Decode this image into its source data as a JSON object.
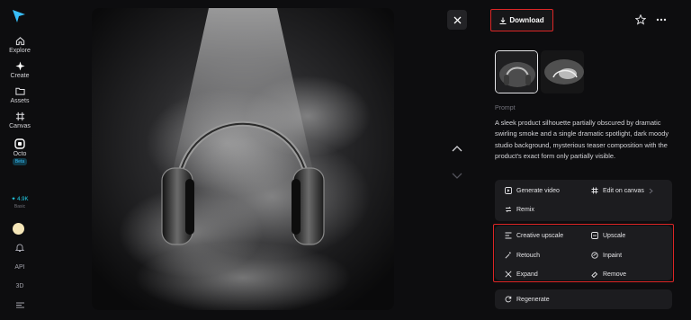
{
  "sidebar": {
    "items": [
      {
        "label": "Explore",
        "icon": "home-icon"
      },
      {
        "label": "Create",
        "icon": "sparkle-icon"
      },
      {
        "label": "Assets",
        "icon": "folder-icon"
      },
      {
        "label": "Canvas",
        "icon": "canvas-icon"
      },
      {
        "label": "Octo",
        "icon": "octo-icon",
        "badge": "Beta"
      }
    ],
    "credits": {
      "value": "4.9K",
      "label": "Basic"
    },
    "bottom": {
      "api": "API",
      "three_d": "3D"
    }
  },
  "viewer": {
    "image_alt": "Headphones silhouette in dramatic swirling smoke under a spotlight"
  },
  "panel": {
    "download_label": "Download",
    "prompt_label": "Prompt",
    "prompt_text": "A sleek product silhouette partially obscured by dramatic swirling smoke and a single dramatic spotlight, dark moody studio background, mysterious teaser composition with the product's exact form only partially visible.",
    "actions_top": {
      "generate_video": "Generate video",
      "edit_on_canvas": "Edit on canvas",
      "remix": "Remix"
    },
    "actions_edit": {
      "creative_upscale": "Creative upscale",
      "upscale": "Upscale",
      "retouch": "Retouch",
      "inpaint": "Inpaint",
      "expand": "Expand",
      "remove": "Remove"
    },
    "regenerate": "Regenerate"
  },
  "colors": {
    "background": "#0d0d0f",
    "card": "#1c1c1f",
    "highlight": "#dc2626",
    "logo": "#38bdf8"
  }
}
